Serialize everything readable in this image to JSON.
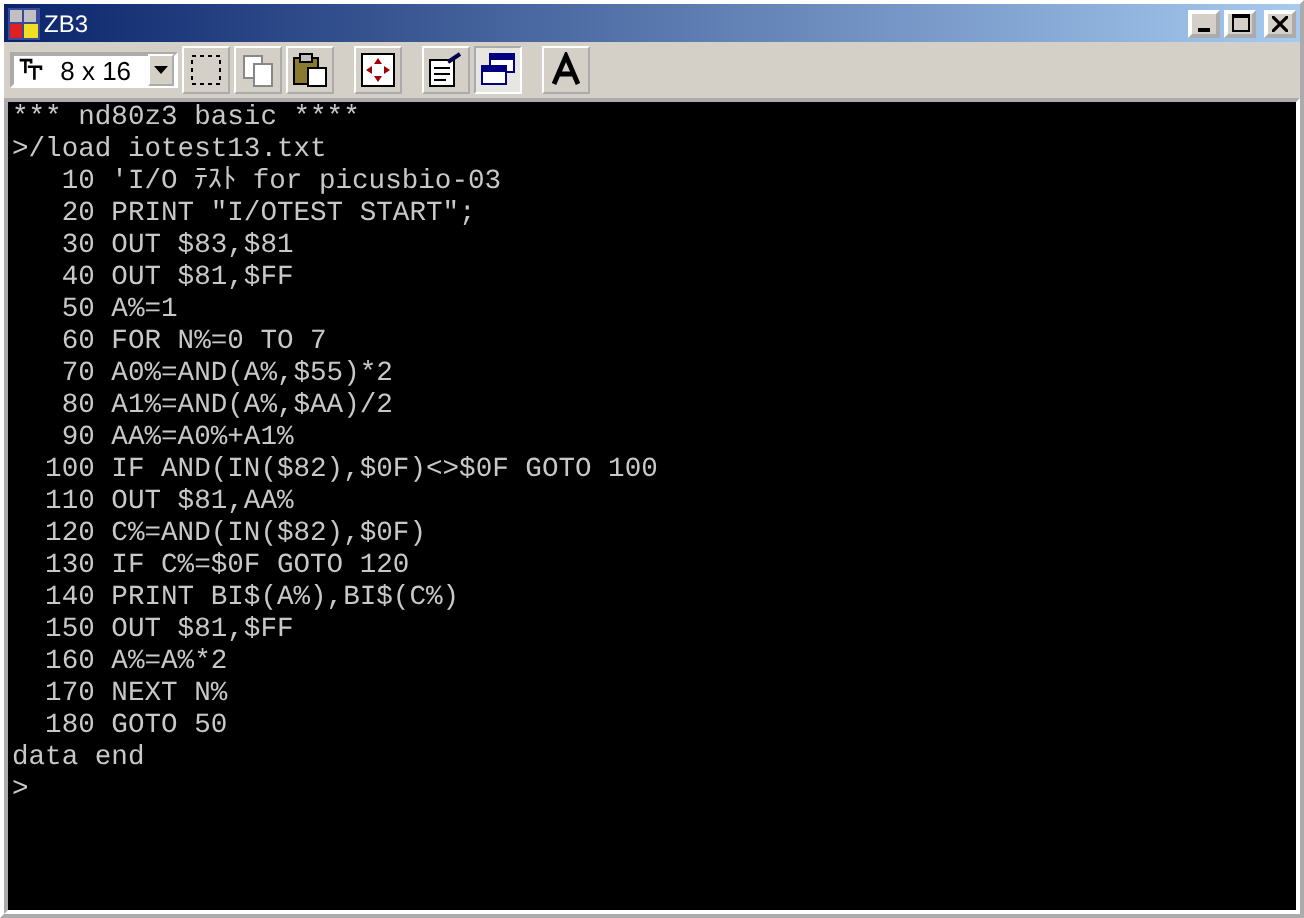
{
  "window": {
    "title": "ZB3"
  },
  "toolbar": {
    "font_size": "8 x 16",
    "buttons": [
      {
        "kind": "select",
        "pressed": false
      },
      {
        "kind": "copy",
        "pressed": false
      },
      {
        "kind": "paste",
        "pressed": false
      },
      {
        "kind": "fit",
        "pressed": false
      },
      {
        "kind": "properties",
        "pressed": false
      },
      {
        "kind": "window",
        "pressed": true
      },
      {
        "kind": "font",
        "pressed": false
      }
    ]
  },
  "terminal": {
    "lines": [
      "*** nd80z3 basic ****",
      ">/load iotest13.txt",
      "   10 'I/O ﾃｽﾄ for picusbio-03",
      "   20 PRINT \"I/OTEST START\";",
      "   30 OUT $83,$81",
      "   40 OUT $81,$FF",
      "   50 A%=1",
      "   60 FOR N%=0 TO 7",
      "   70 A0%=AND(A%,$55)*2",
      "   80 A1%=AND(A%,$AA)/2",
      "   90 AA%=A0%+A1%",
      "  100 IF AND(IN($82),$0F)<>$0F GOTO 100",
      "  110 OUT $81,AA%",
      "  120 C%=AND(IN($82),$0F)",
      "  130 IF C%=$0F GOTO 120",
      "  140 PRINT BI$(A%),BI$(C%)",
      "  150 OUT $81,$FF",
      "  160 A%=A%*2",
      "  170 NEXT N%",
      "  180 GOTO 50",
      "data end",
      ">"
    ]
  }
}
